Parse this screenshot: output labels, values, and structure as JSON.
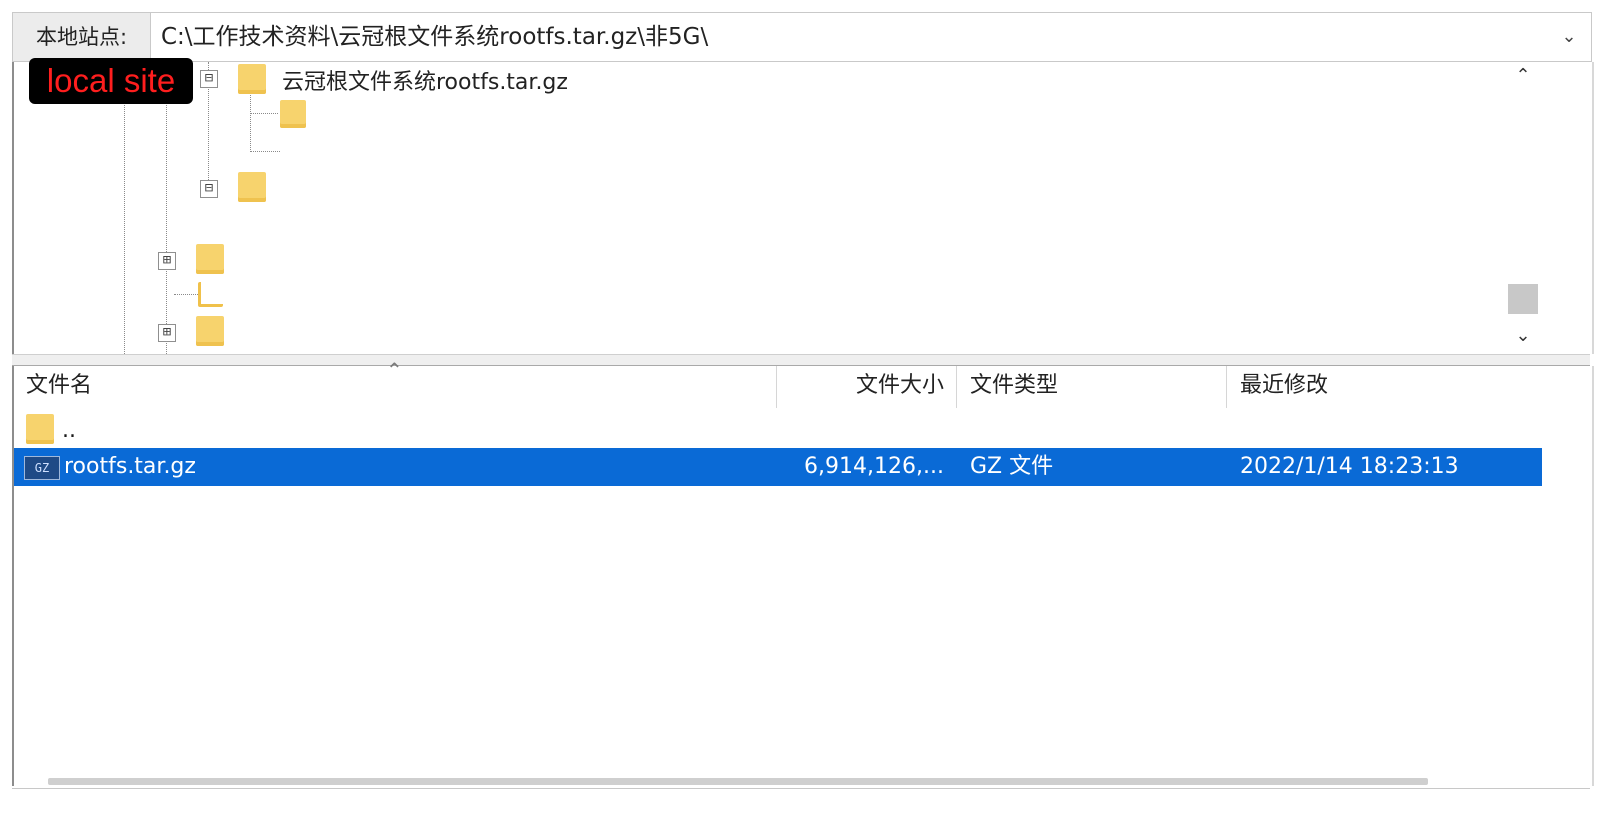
{
  "path_bar": {
    "label": "本地站点:",
    "value": "C:\\工作技术资料\\云冠根文件系统rootfs.tar.gz\\非5G\\",
    "dropdown_icon": "chevron-down-icon"
  },
  "annotation": {
    "badge_text": "local site",
    "badge_color": "#ff1e1e"
  },
  "tree": {
    "expanded_folder_label": "云冠根文件系统rootfs.tar.gz",
    "expand_collapsed_glyph": "⊟",
    "expand_plus_glyph": "⊞"
  },
  "file_list": {
    "columns": [
      "文件名",
      "文件大小",
      "文件类型",
      "最近修改"
    ],
    "rows": [
      {
        "name": "..",
        "size": "",
        "type": "",
        "modified": "",
        "icon": "folder-icon",
        "selected": false
      },
      {
        "name": "rootfs.tar.gz",
        "size": "6,914,126,...",
        "type": "GZ 文件",
        "modified": "2022/1/14 18:23:13",
        "icon": "gz-archive-icon",
        "selected": true
      }
    ],
    "gz_icon_text": "GZ"
  },
  "colors": {
    "selection": "#0a6ad6",
    "folder": "#f7d36d"
  }
}
